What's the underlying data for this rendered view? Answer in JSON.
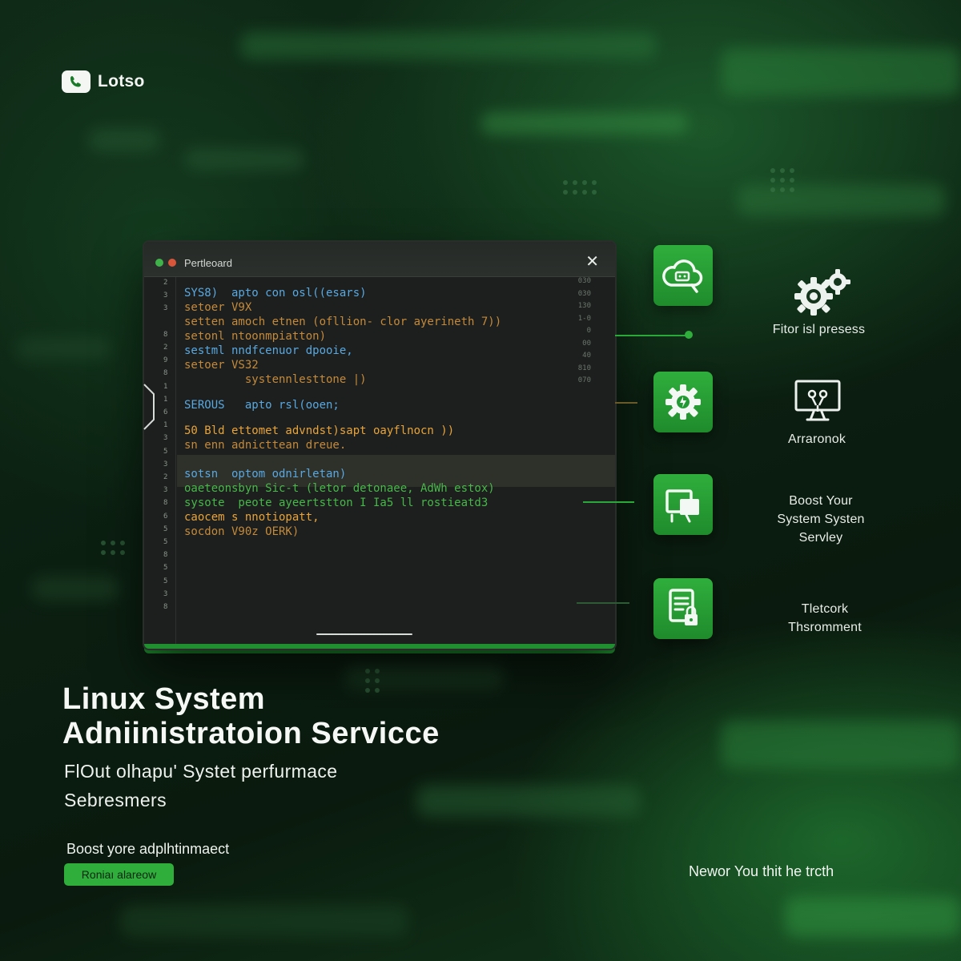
{
  "brand": {
    "name": "Lotso"
  },
  "colors": {
    "accent": "#2fae3c",
    "accent_dark": "#1f8b2c",
    "background": "#0b1f11"
  },
  "terminal": {
    "title": "Pertleoard",
    "line_numbers": [
      "2",
      "3",
      "3",
      "",
      "8",
      "2",
      "9",
      "8",
      "1",
      "1",
      "6",
      "1",
      "3",
      "5",
      "3",
      "2",
      "3",
      "8",
      "6",
      "5",
      "5",
      "8",
      "5",
      "5",
      "3",
      "8"
    ],
    "right_numbers": [
      "030",
      "030",
      "130",
      "1-0",
      "0",
      "00",
      "40",
      "810",
      "070"
    ],
    "code_lines": [
      {
        "text": "SYS8)  apto con osl((esars)",
        "color": "#5aa8e0"
      },
      {
        "text": "setoer V9X",
        "color": "#c48a3c"
      },
      {
        "text": "setten amoch etnen (ofllion- clor ayerineth 7))",
        "color": "#c48a3c"
      },
      {
        "text": "setonl ntoonmpiatton)",
        "color": "#c48a3c"
      },
      {
        "text": "sestml nndfcenuor dpooie,",
        "color": "#5aa8e0"
      },
      {
        "text": "setoer VS32",
        "color": "#c48a3c"
      },
      {
        "text": "         systennlesttone |)",
        "color": "#c48a3c"
      },
      {
        "text": "SEROUS   apto rsl(ooen;",
        "color": "#5aa8e0"
      },
      {
        "text": "50 Bld ettomet advndst)sapt oayflnocn ))",
        "color": "#e8a43c"
      },
      {
        "text": "sn enn adnicttean dreue.",
        "color": "#c48a3c"
      },
      {
        "text": "sotsn  optom odnirletan)",
        "color": "#5aa8e0"
      },
      {
        "text": "oaeteonsbyn Sic-t (letor detonaee, AdWh estox)",
        "color": "#48b84a"
      },
      {
        "text": "sysote  peote ayeertstton I Ia5 ll rostieatd3",
        "color": "#48b84a"
      },
      {
        "text": "caocem s nnotiopatt,",
        "color": "#e8a43c"
      },
      {
        "text": "socdon V90z OERK)",
        "color": "#c48a3c"
      }
    ]
  },
  "features": [
    {
      "label": "Fitor isl presess",
      "tile_icon": "cloud-chat-icon",
      "side_icon": "gears-icon"
    },
    {
      "label": "Arraronok",
      "tile_icon": "settings-gear-icon",
      "side_icon": "monitor-network-icon"
    },
    {
      "label_lines": [
        "Boost Your",
        "System Systen",
        "Servley"
      ],
      "tile_icon": "window-panel-icon"
    },
    {
      "label_lines": [
        "Tletcork",
        "Thsromment"
      ],
      "tile_icon": "document-lock-icon"
    }
  ],
  "hero": {
    "headline_1": "Linux System",
    "headline_2": "Adniinistratoion Servicce",
    "subline_1": "FlOut olhapu' Systet perfurmace",
    "subline_2": "Sebresmers",
    "tagline": "Boost yore adplhtinmaect",
    "cta_label": "Roniaı alareow"
  },
  "footer_note": "Newor You thit he trcth"
}
